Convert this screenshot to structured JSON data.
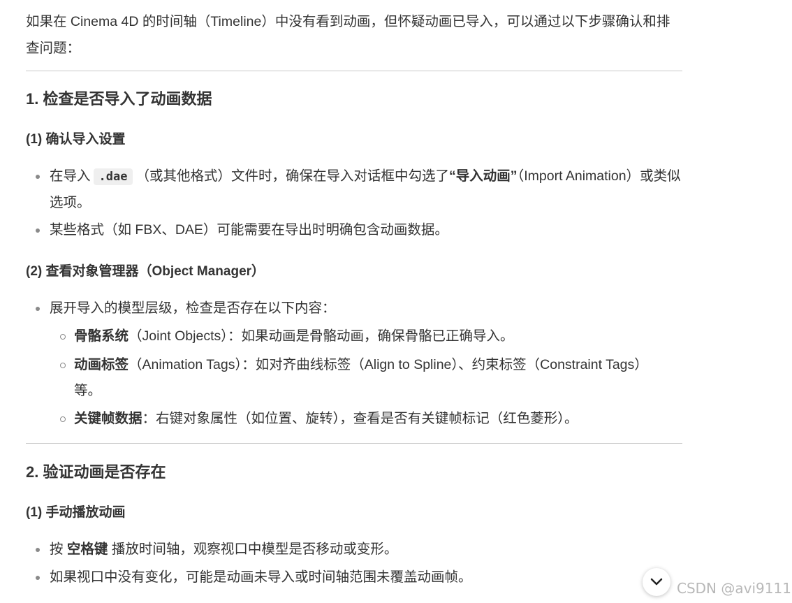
{
  "intro": "如果在 Cinema 4D 的时间轴（Timeline）中没有看到动画，但怀疑动画已导入，可以通过以下步骤确认和排查问题：",
  "section1": {
    "title": "1. 检查是否导入了动画数据",
    "sub1": {
      "title": "(1) 确认导入设置",
      "item1": {
        "pre": "在导入",
        "code": ".dae",
        "mid": "（或其他格式）文件时，确保在导入对话框中勾选了",
        "bold": "“导入动画”",
        "post": "（Import Animation）或类似选项。"
      },
      "item2": "某些格式（如 FBX、DAE）可能需要在导出时明确包含动画数据。"
    },
    "sub2": {
      "title": "(2) 查看对象管理器（Object Manager）",
      "item1": "展开导入的模型层级，检查是否存在以下内容：",
      "subitems": [
        {
          "bold": "骨骼系统",
          "text": "（Joint Objects）：如果动画是骨骼动画，确保骨骼已正确导入。"
        },
        {
          "bold": "动画标签",
          "text": "（Animation Tags）：如对齐曲线标签（Align to Spline）、约束标签（Constraint Tags）等。"
        },
        {
          "bold": "关键帧数据",
          "text": "：右键对象属性（如位置、旋转），查看是否有关键帧标记（红色菱形）。"
        }
      ]
    }
  },
  "section2": {
    "title": "2. 验证动画是否存在",
    "sub1": {
      "title": "(1) 手动播放动画",
      "item1": {
        "pre": "按 ",
        "bold": "空格键",
        "post": " 播放时间轴，观察视口中模型是否移动或变形。"
      },
      "item2": "如果视口中没有变化，可能是动画未导入或时间轴范围未覆盖动画帧。"
    }
  },
  "ui": {
    "scroll_icon": "chevron-down-icon",
    "watermark": "CSDN @avi9111"
  }
}
